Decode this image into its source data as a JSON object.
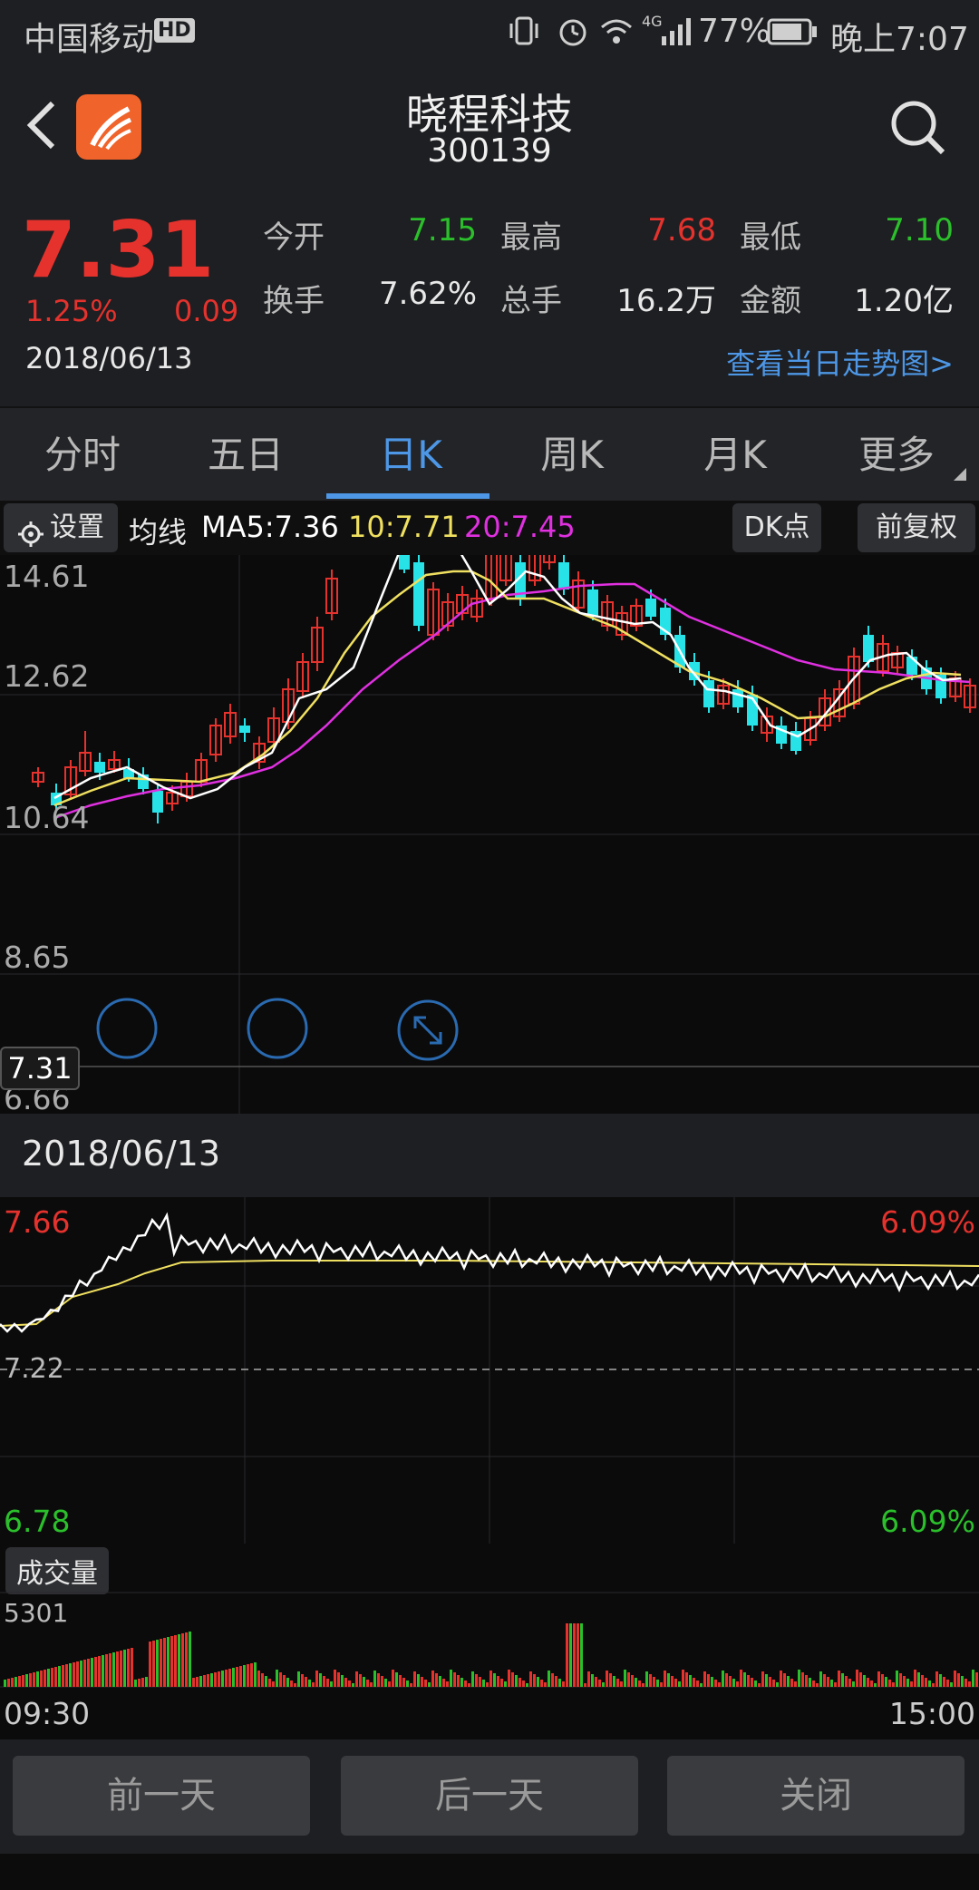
{
  "status_bar": {
    "carrier": "中国移动",
    "hd": "HD",
    "network": "4G",
    "battery": "77%",
    "time": "晚上7:07"
  },
  "header": {
    "stock_name": "晓程科技",
    "stock_code": "300139",
    "logo_color": "#f0632a"
  },
  "quote": {
    "price": "7.31",
    "change_pct": "1.25%",
    "change_abs": "0.09",
    "date": "2018/06/13",
    "open_label": "今开",
    "open": "7.15",
    "high_label": "最高",
    "high": "7.68",
    "low_label": "最低",
    "low": "7.10",
    "turnover_label": "换手",
    "turnover": "7.62%",
    "volume_label": "总手",
    "volume": "16.2万",
    "amount_label": "金额",
    "amount": "1.20亿",
    "trend_link": "查看当日走势图>"
  },
  "tabs": [
    {
      "label": "分时",
      "active": false
    },
    {
      "label": "五日",
      "active": false
    },
    {
      "label": "日K",
      "active": true
    },
    {
      "label": "周K",
      "active": false
    },
    {
      "label": "月K",
      "active": false
    },
    {
      "label": "更多",
      "active": false
    }
  ],
  "toolbar": {
    "settings": "设置",
    "ma_title": "均线",
    "ma5": "MA5:7.36",
    "ma10": "10:7.71",
    "ma20": "20:7.45",
    "dk_button": "DK点",
    "adjust_button": "前复权"
  },
  "kline": {
    "y_labels": [
      "14.61",
      "12.62",
      "10.64",
      "8.65",
      "6.66"
    ],
    "current_price_tag": "7.31",
    "ma_colors": {
      "ma5": "#ffffff",
      "ma10": "#f0e060",
      "ma20": "#e030e0"
    },
    "up_color": "#e5322d",
    "down_color": "#27e3e8"
  },
  "intraday": {
    "date": "2018/06/13",
    "top_price": "7.66",
    "top_pct": "6.09%",
    "mid_price": "7.22",
    "bottom_price": "6.78",
    "bottom_pct": "6.09%"
  },
  "volume": {
    "label": "成交量",
    "max": "5301",
    "start_time": "09:30",
    "end_time": "15:00"
  },
  "bottom_buttons": {
    "prev": "前一天",
    "next": "后一天",
    "close": "关闭"
  }
}
